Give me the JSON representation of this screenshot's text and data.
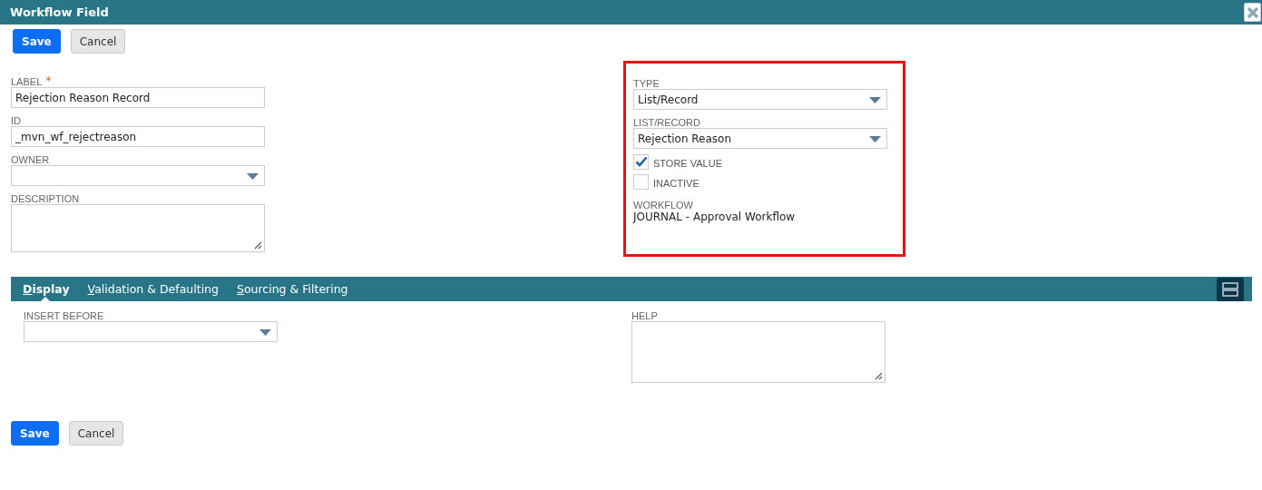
{
  "window": {
    "title": "Workflow Field"
  },
  "top_buttons": [
    {
      "label": "Save",
      "kind": "primary"
    },
    {
      "label": "Cancel",
      "kind": "secondary"
    }
  ],
  "left_fields": [
    {
      "label": "LABEL",
      "required_mark": "*",
      "kind": "text",
      "value": "Rejection Reason Record"
    },
    {
      "label": "ID",
      "kind": "text",
      "value": "_mvn_wf_rejectreason"
    },
    {
      "label": "OWNER",
      "kind": "select"
    },
    {
      "label": "DESCRIPTION",
      "kind": "textarea"
    }
  ],
  "right_panel": {
    "highlighted": true,
    "fields": [
      {
        "label": "TYPE",
        "kind": "select",
        "value": "List/Record"
      },
      {
        "label": "LIST/RECORD",
        "kind": "select",
        "value": "Rejection Reason"
      }
    ],
    "checkboxes": [
      {
        "label": "STORE VALUE",
        "checked": true
      },
      {
        "label": "INACTIVE",
        "checked": false
      }
    ],
    "workflow": {
      "label": "WORKFLOW",
      "value": "JOURNAL - Approval Workflow"
    }
  },
  "tabs": [
    {
      "label": "Display",
      "selected": true
    },
    {
      "label": "Validation & Defaulting",
      "selected": false
    },
    {
      "label": "Sourcing & Filtering",
      "selected": false
    }
  ],
  "tab_fields": [
    {
      "label": "INSERT BEFORE",
      "kind": "select"
    },
    {
      "label": "HELP",
      "kind": "textarea"
    }
  ],
  "bottom_buttons": [
    {
      "label": "Save",
      "kind": "primary"
    },
    {
      "label": "Cancel",
      "kind": "secondary"
    }
  ]
}
